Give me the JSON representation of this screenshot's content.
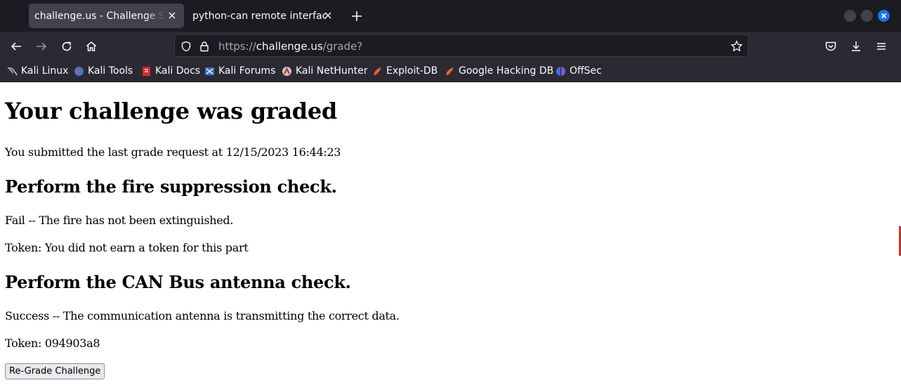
{
  "browser": {
    "tabs": [
      {
        "title": "challenge.us - Challenge Success",
        "active": true
      },
      {
        "title": "python-can remote interface",
        "active": false
      }
    ],
    "url": {
      "scheme": "https://",
      "host": "challenge.us",
      "path": "/grade?"
    },
    "bookmarks": [
      {
        "label": "Kali Linux",
        "icon": "kali-dragon-icon"
      },
      {
        "label": "Kali Tools",
        "icon": "kali-tools-icon"
      },
      {
        "label": "Kali Docs",
        "icon": "kali-docs-icon"
      },
      {
        "label": "Kali Forums",
        "icon": "kali-forums-icon"
      },
      {
        "label": "Kali NetHunter",
        "icon": "kali-nethunter-icon"
      },
      {
        "label": "Exploit-DB",
        "icon": "exploit-db-icon"
      },
      {
        "label": "Google Hacking DB",
        "icon": "ghdb-icon"
      },
      {
        "label": "OffSec",
        "icon": "offsec-icon"
      }
    ],
    "colors": {
      "tabstrip": "#1c1b22",
      "toolbar": "#2b2a33",
      "active_tab": "#42414d",
      "close_window": "#1a73e8"
    }
  },
  "page": {
    "title": "Your challenge was graded",
    "submitted": "You submitted the last grade request at 12/15/2023 16:44:23",
    "checks": [
      {
        "heading": "Perform the fire suppression check.",
        "result": "Fail -- The fire has not been extinguished.",
        "token": "Token: You did not earn a token for this part"
      },
      {
        "heading": "Perform the CAN Bus antenna check.",
        "result": "Success -- The communication antenna is transmitting the correct data.",
        "token": "Token: 094903a8"
      }
    ],
    "button_label": "Re-Grade Challenge"
  }
}
